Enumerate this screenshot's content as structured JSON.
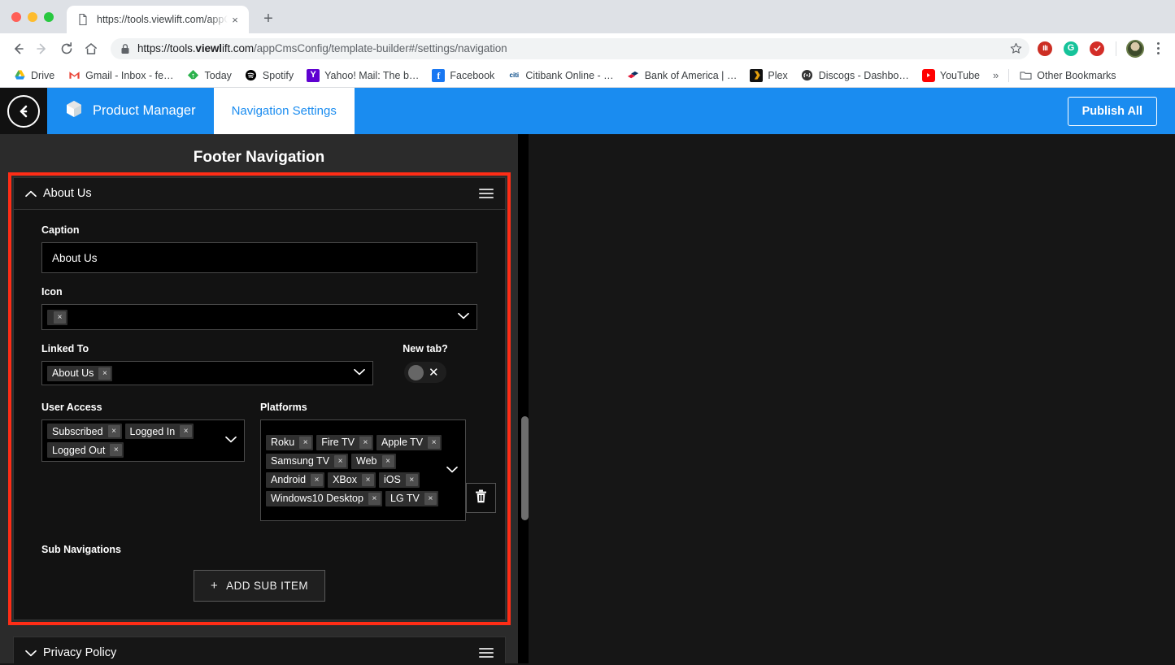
{
  "browser": {
    "tab": {
      "title": "https://tools.viewlift.com/appC",
      "favicon": "page-icon",
      "close": "×"
    },
    "newtab_label": "+",
    "nav": {
      "back": "←",
      "forward": "→",
      "reload": "↻",
      "home": "⌂"
    },
    "omnibox": {
      "lock": "lock-icon",
      "scheme": "https://",
      "host_pre": "tools.",
      "host_bold": "viewl",
      "host_post": "ift.com",
      "path": "/appCmsConfig/template-builder#/settings/navigation",
      "full_url": "https://tools.viewlift.com/appCmsConfig/template-builder#/settings/navigation"
    },
    "star": "☆",
    "extensions": [
      {
        "name": "ublock-extension-icon",
        "glyph": "✋",
        "color": "#cc2e24"
      },
      {
        "name": "grammarly-extension-icon",
        "glyph": "G",
        "color": "#15c39a"
      },
      {
        "name": "lastpass-extension-icon",
        "glyph": "✓",
        "color": "#d32d27"
      }
    ],
    "bookmarks": [
      {
        "label": "Drive",
        "icon": "drive-icon",
        "color": "#ffc107"
      },
      {
        "label": "Gmail - Inbox - fe…",
        "icon": "gmail-icon",
        "color": "#ea4335"
      },
      {
        "label": "Today",
        "icon": "feedly-icon",
        "color": "#2bb24c"
      },
      {
        "label": "Spotify",
        "icon": "spotify-icon",
        "color": "#000000"
      },
      {
        "label": "Yahoo! Mail: The b…",
        "icon": "yahoo-icon",
        "color": "#5f01d1"
      },
      {
        "label": "Facebook",
        "icon": "facebook-icon",
        "color": "#1877f2"
      },
      {
        "label": "Citibank Online - …",
        "icon": "citi-icon",
        "color": "#004685"
      },
      {
        "label": "Bank of America | …",
        "icon": "bofa-icon",
        "color": "#e31837"
      },
      {
        "label": "Plex",
        "icon": "plex-icon",
        "color": "#e5a00d"
      },
      {
        "label": "Discogs - Dashbo…",
        "icon": "discogs-icon",
        "color": "#333333"
      },
      {
        "label": "YouTube",
        "icon": "youtube-icon",
        "color": "#ff0000"
      }
    ],
    "bookmarks_overflow": "»",
    "other_bookmarks": {
      "label": "Other Bookmarks",
      "icon": "folder-icon"
    }
  },
  "appbar": {
    "back_button": "back-arrow",
    "brand_label": "Product Manager",
    "brand_icon": "cube-icon",
    "tab_label": "Navigation Settings",
    "publish_label": "Publish All",
    "accent_color": "#1a8cf0"
  },
  "panel": {
    "title": "Footer Navigation",
    "highlight_color": "#ff2d16"
  },
  "card": {
    "title": "About Us",
    "collapsed": false,
    "caption": {
      "label": "Caption",
      "value": "About Us"
    },
    "icon": {
      "label": "Icon",
      "chips": [
        {
          "label": "",
          "remove": "×"
        }
      ]
    },
    "linked_to": {
      "label": "Linked To",
      "chips": [
        {
          "label": "About Us",
          "remove": "×"
        }
      ]
    },
    "new_tab": {
      "label": "New tab?",
      "state": "off",
      "mark": "✕"
    },
    "user_access": {
      "label": "User Access",
      "chips": [
        {
          "label": "Subscribed",
          "remove": "×"
        },
        {
          "label": "Logged In",
          "remove": "×"
        },
        {
          "label": "Logged Out",
          "remove": "×"
        }
      ]
    },
    "platforms": {
      "label": "Platforms",
      "chips": [
        {
          "label": "Roku",
          "remove": "×"
        },
        {
          "label": "Fire TV",
          "remove": "×"
        },
        {
          "label": "Apple TV",
          "remove": "×"
        },
        {
          "label": "Samsung TV",
          "remove": "×"
        },
        {
          "label": "Web",
          "remove": "×"
        },
        {
          "label": "Android",
          "remove": "×"
        },
        {
          "label": "XBox",
          "remove": "×"
        },
        {
          "label": "iOS",
          "remove": "×"
        },
        {
          "label": "Windows10 Desktop",
          "remove": "×"
        },
        {
          "label": "LG TV",
          "remove": "×"
        }
      ]
    },
    "delete_button": "trash-icon",
    "sub_navigations": {
      "label": "Sub Navigations",
      "add_label": "ADD SUB ITEM",
      "add_plus": "+"
    }
  },
  "card2": {
    "title": "Privacy Policy",
    "collapsed": true
  }
}
